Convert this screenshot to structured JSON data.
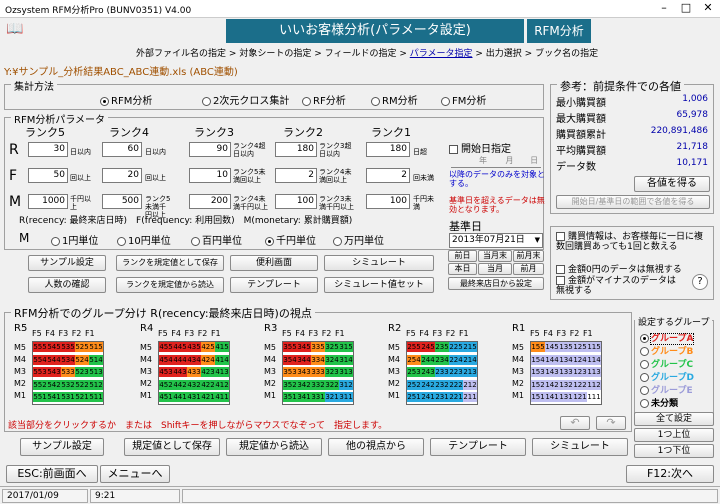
{
  "window": {
    "title": "Ozsystem RFM分析Pro (BUNV0351)  V4.00"
  },
  "header": {
    "title": "いいお客様分析(パラメータ設定)",
    "badge": "RFM分析"
  },
  "steps": {
    "s1": "外部ファイル名の指定",
    "s2": "対象シートの指定",
    "s3": "フィールドの指定",
    "s4": "パラメータ指定",
    "s5": "出力選択",
    "s6": "ブック名の指定",
    "sep": ">"
  },
  "filepath": "Y:¥サンプル_分析結果ABC_ABC連動.xls (ABC連動)",
  "method": {
    "legend": "集計方法",
    "options": [
      "RFM分析",
      "2次元クロス集計",
      "RF分析",
      "RM分析",
      "FM分析"
    ],
    "selected": 0
  },
  "params": {
    "legend": "RFM分析パラメータ",
    "ranks": [
      "ランク5",
      "ランク4",
      "ランク3",
      "ランク2",
      "ランク1"
    ],
    "r_label": "R",
    "f_label": "F",
    "m_label": "M",
    "r_values": [
      "30",
      "60",
      "90",
      "180",
      "180"
    ],
    "f_values": [
      "50",
      "20",
      "10",
      "2",
      "2"
    ],
    "m_values": [
      "1000",
      "500",
      "200",
      "100",
      "100"
    ],
    "r_unit": "日以内",
    "r_unit2": "日超",
    "f_unit": "回以上",
    "f_unit2": "回未満",
    "m_unit": "千円以上",
    "m_unit2": "千円未満",
    "r_note1": "ランク4超日以内",
    "r_note2": "ランク3超日以内",
    "r_note3": "ランク2超日以内",
    "f_note1": "ランク5未満回以上",
    "f_note2": "ランク4未満回以上",
    "f_note3": "ランク3未満回以上",
    "m_note1": "ランク5未満千円以上",
    "m_note2": "ランク4未満千円以上",
    "m_note3": "ランク3未満千円以上",
    "legend_text": "R(recency: 最終来店日時)　F(frequency: 利用回数)　M(monetary: 累計購買額)",
    "m_unit_label": "M",
    "m_units": [
      "1円単位",
      "10円単位",
      "百円単位",
      "千円単位",
      "万円単位"
    ],
    "m_unit_selected": 3
  },
  "startdate": {
    "label": "開始日指定",
    "year": "年",
    "month": "月",
    "day": "日",
    "note1": "以降のデータのみを対象とする。",
    "note2": "基準日を超えるデータは無効となります。"
  },
  "basedate": {
    "label": "基準日",
    "value": "2013年07月21日",
    "btns": [
      "前日",
      "当月末",
      "前月末",
      "本日",
      "当月",
      "前月"
    ],
    "btn_last": "最終来店日から設定"
  },
  "reference": {
    "legend": "参考：前提条件での各値",
    "rows": [
      {
        "label": "最小購買額",
        "value": "1,006"
      },
      {
        "label": "最大購買額",
        "value": "65,978"
      },
      {
        "label": "購買額累計",
        "value": "220,891,486"
      },
      {
        "label": "平均購買額",
        "value": "21,718"
      },
      {
        "label": "データ数",
        "value": "10,171"
      }
    ],
    "get_btn": "各値を得る",
    "range_btn": "開始日/基準日の範囲で各値を得る"
  },
  "options": {
    "opt1": "購買情報は、お客様毎に一日に複数回購買あっても1回と数える",
    "opt2": "金額0円のデータは無視する",
    "opt3": "金額がマイナスのデータは無視する"
  },
  "actions": {
    "sample": "サンプル設定",
    "save_rank": "ランクを規定値として保存",
    "convenience": "便利画面",
    "simulate": "シミュレート",
    "people": "人数の確認",
    "load_rank": "ランクを規定値から読込",
    "template": "テンプレート",
    "sim_set": "シミュレート値セット"
  },
  "grid": {
    "legend": "RFM分析でのグループ分け  R(recency:最終来店日時)の視点",
    "groups": [
      "R5",
      "R4",
      "R3",
      "R2",
      "R1"
    ],
    "fhead": "F5 F4 F3 F2 F1",
    "mrows": [
      "M5",
      "M4",
      "M3",
      "M2",
      "M1"
    ],
    "cells": [
      [
        [
          "555",
          "545",
          "535",
          "525",
          "515"
        ],
        [
          "554",
          "544",
          "534",
          "524",
          "514"
        ],
        [
          "553",
          "543",
          "533",
          "523",
          "513"
        ],
        [
          "552",
          "542",
          "532",
          "522",
          "512"
        ],
        [
          "551",
          "541",
          "531",
          "521",
          "511"
        ]
      ],
      [
        [
          "455",
          "445",
          "435",
          "425",
          "415"
        ],
        [
          "454",
          "444",
          "434",
          "424",
          "414"
        ],
        [
          "453",
          "443",
          "433",
          "423",
          "413"
        ],
        [
          "452",
          "442",
          "432",
          "422",
          "412"
        ],
        [
          "451",
          "441",
          "431",
          "421",
          "411"
        ]
      ],
      [
        [
          "355",
          "345",
          "335",
          "325",
          "315"
        ],
        [
          "354",
          "344",
          "334",
          "324",
          "314"
        ],
        [
          "353",
          "343",
          "333",
          "323",
          "313"
        ],
        [
          "352",
          "342",
          "332",
          "322",
          "312"
        ],
        [
          "351",
          "341",
          "331",
          "321",
          "311"
        ]
      ],
      [
        [
          "255",
          "245",
          "235",
          "225",
          "215"
        ],
        [
          "254",
          "244",
          "234",
          "224",
          "214"
        ],
        [
          "253",
          "243",
          "233",
          "223",
          "213"
        ],
        [
          "252",
          "242",
          "232",
          "222",
          "212"
        ],
        [
          "251",
          "241",
          "231",
          "221",
          "211"
        ]
      ],
      [
        [
          "155",
          "145",
          "135",
          "125",
          "115"
        ],
        [
          "154",
          "144",
          "134",
          "124",
          "114"
        ],
        [
          "153",
          "143",
          "133",
          "123",
          "113"
        ],
        [
          "152",
          "142",
          "132",
          "122",
          "112"
        ],
        [
          "151",
          "141",
          "131",
          "121",
          "111"
        ]
      ]
    ],
    "note": "該当部分をクリックするか　または　Shiftキーを押しながらマウスでなぞって　指定します。",
    "colors": {
      "A": "#e0221e",
      "B": "#ff8c1a",
      "C": "#22c34a",
      "D": "#29a9e0",
      "E": "#bebef0",
      "none": "#ffffff"
    }
  },
  "groupset": {
    "legend": "設定するグループ",
    "items": [
      "グループA",
      "グループB",
      "グループC",
      "グループD",
      "グループE",
      "未分類"
    ],
    "selected": 0,
    "all": "全て設定",
    "up": "1つ上位",
    "down": "1つ下位"
  },
  "bottom": {
    "sample": "サンプル設定",
    "save": "規定値として保存",
    "load": "規定値から読込",
    "other": "他の視点から",
    "template": "テンプレート",
    "simulate": "シミュレート"
  },
  "footer": {
    "esc": "ESC:前画面へ",
    "menu": "メニューへ",
    "next": "F12:次へ"
  },
  "status": {
    "date": "2017/01/09",
    "time": "9:21"
  }
}
